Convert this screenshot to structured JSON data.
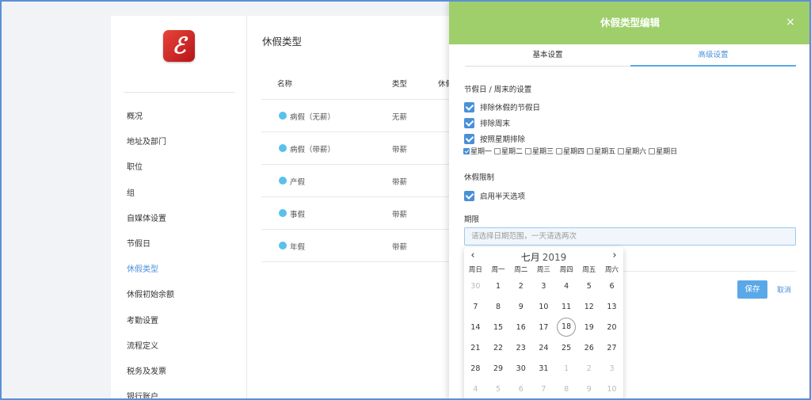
{
  "sidebar": {
    "items": [
      {
        "label": "概况"
      },
      {
        "label": "地址及部门"
      },
      {
        "label": "职位"
      },
      {
        "label": "组"
      },
      {
        "label": "自媒体设置"
      },
      {
        "label": "节假日"
      },
      {
        "label": "休假类型",
        "active": true
      },
      {
        "label": "休假初始余额"
      },
      {
        "label": "考勤设置"
      },
      {
        "label": "流程定义"
      },
      {
        "label": "税务及发票"
      },
      {
        "label": "银行账户"
      }
    ],
    "brand_color": "#d32027"
  },
  "main": {
    "title": "休假类型",
    "columns": [
      "名称",
      "类型",
      "休假"
    ],
    "rows": [
      {
        "name": "病假（无薪）",
        "type": "无薪"
      },
      {
        "name": "病假（带薪）",
        "type": "带薪"
      },
      {
        "name": "产假",
        "type": "带薪"
      },
      {
        "name": "事假",
        "type": "带薪"
      },
      {
        "name": "年假",
        "type": "带薪"
      }
    ],
    "dot_color": "#5bc0eb"
  },
  "modal": {
    "title": "休假类型编辑",
    "header_color": "#9ecf6b",
    "tabs": [
      {
        "label": "基本设置"
      },
      {
        "label": "高级设置",
        "active": true
      }
    ],
    "holiday_section": {
      "title": "节假日 / 周末的设置",
      "exclude_holidays": "排除休假的节假日",
      "exclude_weekends": "排除周末",
      "exclude_by_weekday": "按照星期排除"
    },
    "weekdays": [
      {
        "label": "星期一",
        "checked": true
      },
      {
        "label": "星期二",
        "checked": false
      },
      {
        "label": "星期三",
        "checked": false
      },
      {
        "label": "星期四",
        "checked": false
      },
      {
        "label": "星期五",
        "checked": false
      },
      {
        "label": "星期六",
        "checked": false
      },
      {
        "label": "星期日",
        "checked": false
      }
    ],
    "limit_section": {
      "title": "休假限制",
      "half_day": "启用半天选项"
    },
    "period": {
      "title": "期限",
      "placeholder": "请选择日期范围，一天请选两次"
    },
    "save_label": "保存",
    "cancel_label": "取消"
  },
  "calendar": {
    "month": "七月",
    "year": "2019",
    "weekday_headers": [
      "周日",
      "周一",
      "周二",
      "周三",
      "周四",
      "周五",
      "周六"
    ],
    "weeks": [
      [
        "30",
        "1",
        "2",
        "3",
        "4",
        "5",
        "6"
      ],
      [
        "7",
        "8",
        "9",
        "10",
        "11",
        "12",
        "13"
      ],
      [
        "14",
        "15",
        "16",
        "17",
        "18",
        "19",
        "20"
      ],
      [
        "21",
        "22",
        "23",
        "24",
        "25",
        "26",
        "27"
      ],
      [
        "28",
        "29",
        "30",
        "31",
        "1",
        "2",
        "3"
      ],
      [
        "4",
        "5",
        "6",
        "7",
        "8",
        "9",
        "10"
      ]
    ],
    "today": "18"
  }
}
